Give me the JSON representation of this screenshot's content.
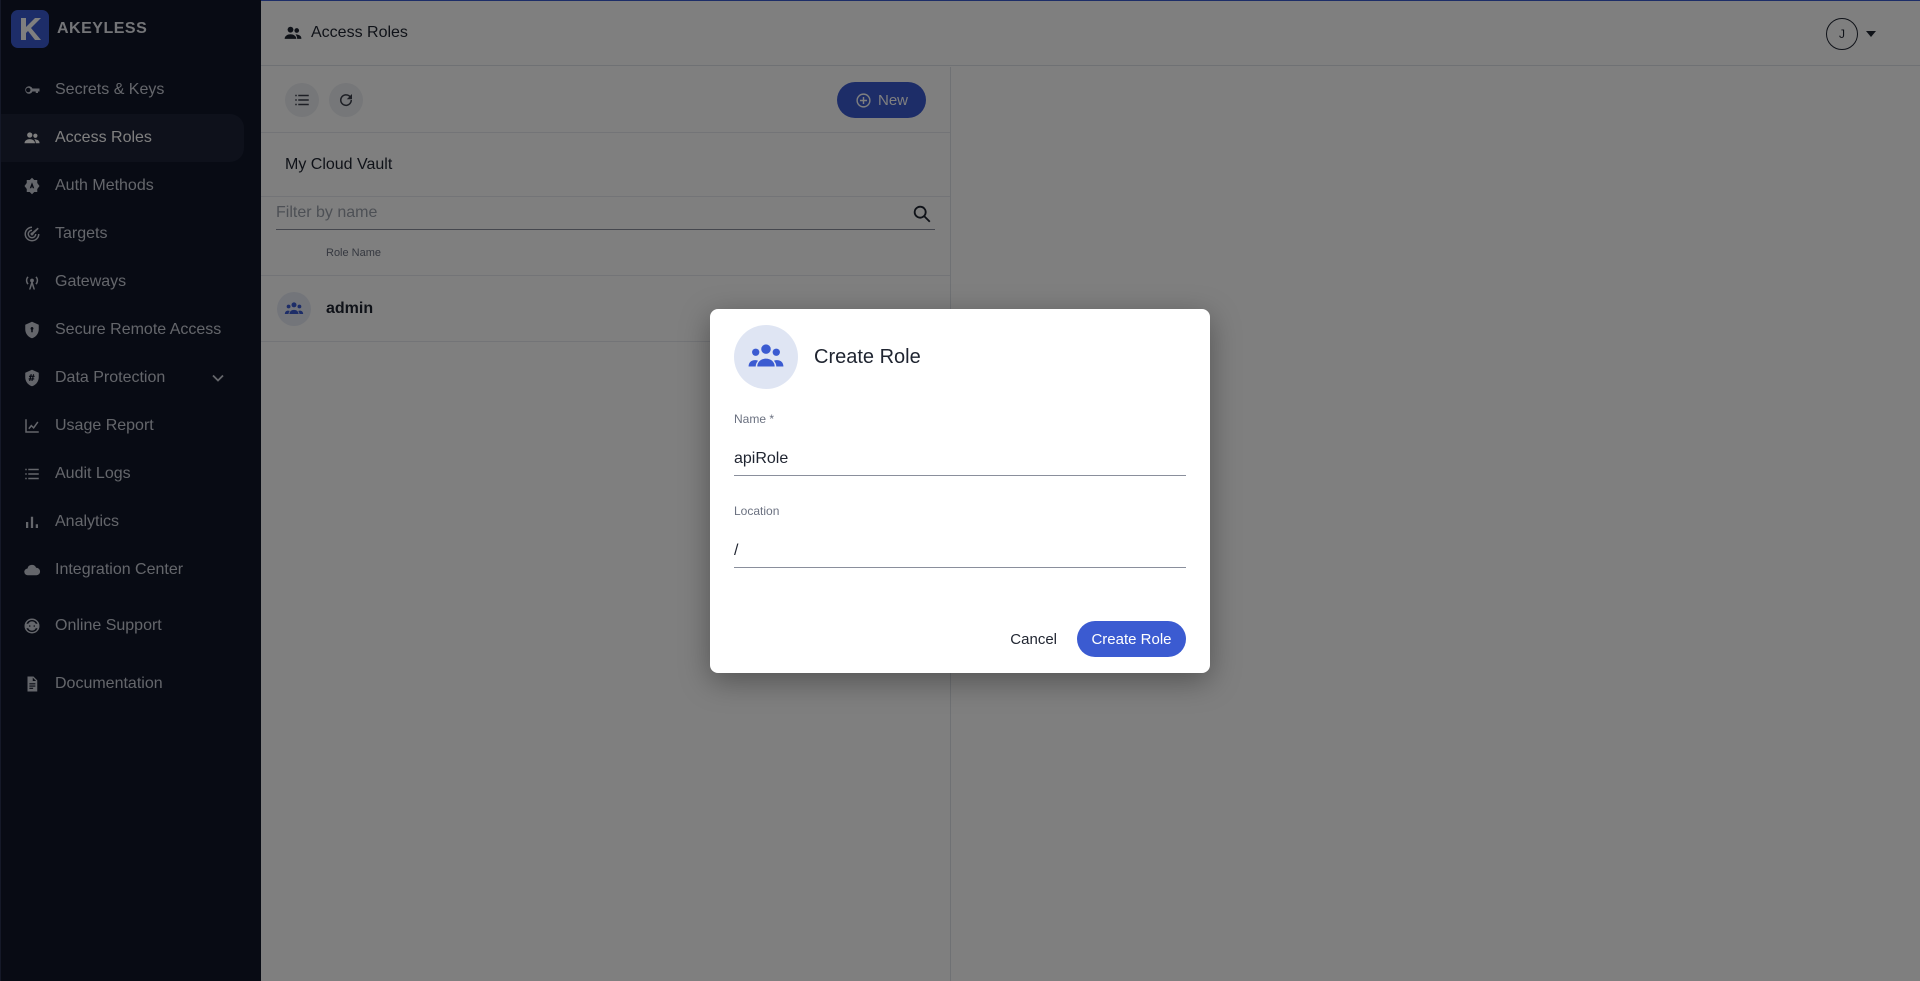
{
  "brand": {
    "name": "AKEYLESS",
    "logo_letter": "K",
    "accent": "#3b5bd1"
  },
  "sidebar": {
    "items": [
      {
        "label": "Secrets & Keys",
        "icon": "key-icon"
      },
      {
        "label": "Access Roles",
        "icon": "people-icon",
        "active": true
      },
      {
        "label": "Auth Methods",
        "icon": "auth-badge-icon"
      },
      {
        "label": "Targets",
        "icon": "target-icon"
      },
      {
        "label": "Gateways",
        "icon": "gateway-antenna-icon"
      },
      {
        "label": "Secure Remote Access",
        "icon": "shield-lock-icon"
      },
      {
        "label": "Data Protection",
        "icon": "shield-hash-icon",
        "expandable": true
      },
      {
        "label": "Usage Report",
        "icon": "chart-icon"
      },
      {
        "label": "Audit Logs",
        "icon": "list-icon"
      },
      {
        "label": "Analytics",
        "icon": "bar-chart-icon"
      },
      {
        "label": "Integration Center",
        "icon": "cloud-icon"
      },
      {
        "label": "Online Support",
        "icon": "support-icon"
      },
      {
        "label": "Documentation",
        "icon": "document-icon"
      }
    ]
  },
  "topbar": {
    "title": "Access Roles",
    "user_initial": "J"
  },
  "panel": {
    "new_label": "New",
    "vault_name": "My Cloud Vault",
    "filter_placeholder": "Filter by name",
    "column_header": "Role Name",
    "rows": [
      {
        "name": "admin"
      }
    ]
  },
  "dialog": {
    "title": "Create Role",
    "name_label": "Name *",
    "name_value": "apiRole",
    "location_label": "Location",
    "location_value": "/",
    "cancel_label": "Cancel",
    "create_label": "Create Role"
  }
}
